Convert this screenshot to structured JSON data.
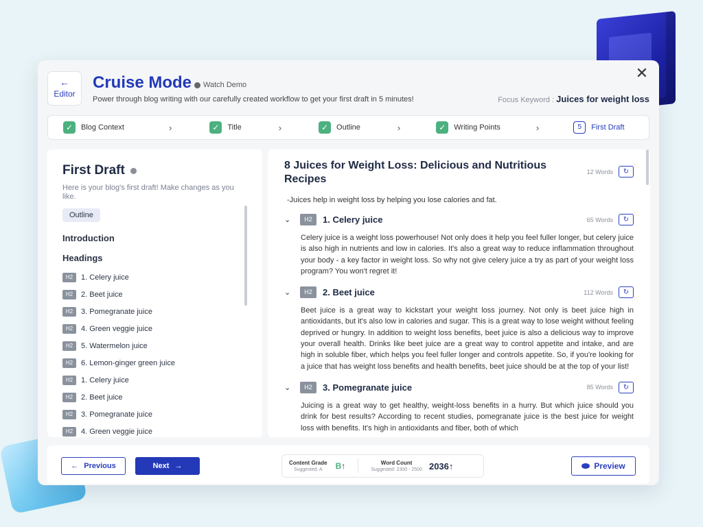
{
  "header": {
    "editor_label": "Editor",
    "editor_arrow": "←",
    "title": "Cruise Mode",
    "watch_demo": "Watch Demo",
    "subtitle": "Power through blog writing with our carefully created workflow to get your first draft in 5 minutes!",
    "focus_label": "Focus Keyword : ",
    "focus_value": "Juices for weight loss",
    "close": "✕"
  },
  "steps": [
    {
      "label": "Blog Context",
      "status": "done"
    },
    {
      "label": "Title",
      "status": "done"
    },
    {
      "label": "Outline",
      "status": "done"
    },
    {
      "label": "Writing Points",
      "status": "done"
    },
    {
      "label": "First Draft",
      "status": "active",
      "number": "5"
    }
  ],
  "step_check": "✓",
  "step_chevron": "›",
  "left": {
    "title": "First Draft",
    "subtitle": "Here is your blog's first draft! Make changes as you like.",
    "outline_chip": "Outline",
    "introduction": "Introduction",
    "headings": "Headings",
    "tag": "H2",
    "items": [
      "1. Celery juice",
      "2. Beet juice",
      "3. Pomegranate juice",
      "4. Green veggie juice",
      "5. Watermelon juice",
      "6. Lemon-ginger green juice",
      "1. Celery juice",
      "2. Beet juice",
      "3. Pomegranate juice",
      "4. Green veggie juice"
    ]
  },
  "right": {
    "title": "8 Juices for Weight Loss: Delicious and Nutritious Recipes",
    "title_words": "12 Words",
    "intro": "-Juices help in weight loss by helping you lose calories and fat.",
    "refresh_icon": "↻",
    "caret": "⌄",
    "sections": [
      {
        "tag": "H2",
        "title": "1. Celery juice",
        "words": "65 Words",
        "body": "Celery juice is a weight loss powerhouse! Not only does it help you feel fuller longer, but celery juice is also high in nutrients and low in calories. It's also a great way to reduce inflammation throughout your body - a key factor in weight loss. So why not give celery juice a try as part of your weight loss program? You won't regret it!"
      },
      {
        "tag": "H2",
        "title": "2. Beet juice",
        "words": "112 Words",
        "body": "Beet juice is a great way to kickstart your weight loss journey. Not only is beet juice high in antioxidants, but it's also low in calories and sugar. This is a great way to lose weight without feeling deprived or hungry. In addition to weight loss benefits, beet juice is also a delicious way to improve your overall health. Drinks like beet juice are a great way to control appetite and intake, and are high in soluble fiber, which helps you feel fuller longer and controls appetite. So, if you're looking for a juice that has weight loss benefits and health benefits, beet juice should be at the top of your list!"
      },
      {
        "tag": "H2",
        "title": "3. Pomegranate juice",
        "words": "85 Words",
        "body": "Juicing is a great way to get healthy, weight-loss benefits in a hurry. But which juice should you drink for best results? According to recent studies, pomegranate juice is the best juice for weight loss with benefits. It's high in antioxidants and fiber, both of which"
      }
    ]
  },
  "footer": {
    "prev_label": "Previous",
    "prev_arrow": "←",
    "next_label": "Next",
    "next_arrow": "→",
    "grade_label": "Content Grade",
    "grade_suggested": "Suggested: A",
    "grade_value": "B",
    "grade_arrow": "↑",
    "wc_label": "Word Count",
    "wc_suggested": "Suggested: 2300 - 2500",
    "wc_value": "2036",
    "wc_arrow": "↑",
    "preview_label": "Preview"
  }
}
